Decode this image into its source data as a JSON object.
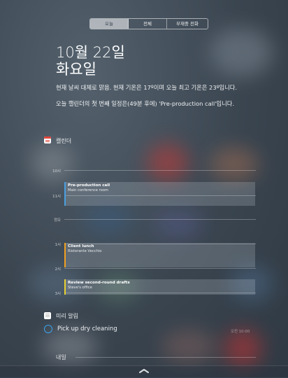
{
  "tabs": [
    {
      "label": "오늘",
      "active": true
    },
    {
      "label": "전체",
      "active": false
    },
    {
      "label": "부재중 전화",
      "active": false
    }
  ],
  "date": {
    "line1": "10월 22일",
    "line2": "화요일"
  },
  "summary": {
    "weather": "현재 날씨 대체로 맑음. 현재 기온은 17º이며 오늘 최고 기온은 23º입니다.",
    "calendar": "오늘 캘린더의 첫 번째 일정은(49분 후에) 'Pre-production call'입니다."
  },
  "calendar": {
    "title": "캘린더",
    "hours": [
      "10시",
      "11시",
      "정오",
      "1시",
      "2시",
      "3시"
    ],
    "events": [
      {
        "title": "Pre-production call",
        "location": "Main conference room",
        "color": "#4a9fe0"
      },
      {
        "title": "Client lunch",
        "location": "Ristorante Vecchio",
        "color": "#f0a020"
      },
      {
        "title": "Review second-round drafts",
        "location": "Steve's office",
        "color": "#e8d030"
      }
    ]
  },
  "reminders": {
    "title": "미리 알림",
    "items": [
      {
        "text": "Pick up dry cleaning",
        "time": "오전 10:00"
      }
    ]
  },
  "tomorrow": {
    "title": "내일"
  },
  "icons": {
    "calendar": "calendar-icon",
    "reminders": "reminders-icon",
    "grabber": "chevron-up-icon"
  }
}
